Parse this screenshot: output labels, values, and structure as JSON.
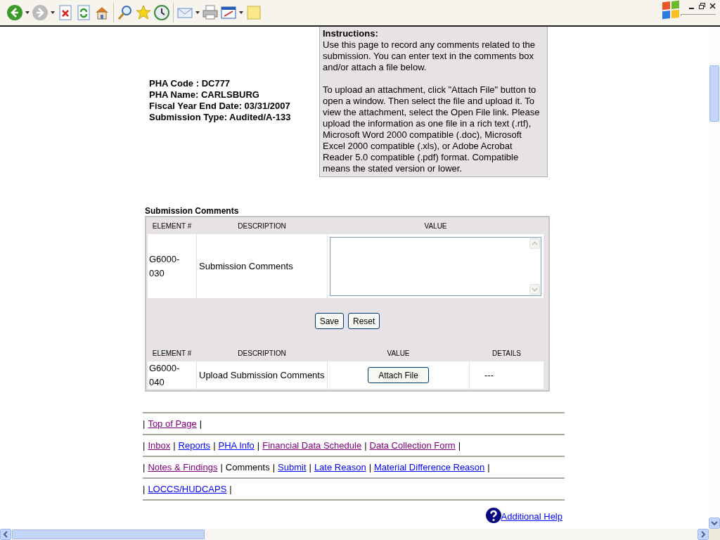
{
  "pha_info": [
    "PHA Code : DC777",
    "PHA Name: CARLSBURG",
    "Fiscal Year End Date: 03/31/2007",
    "Submission Type: Audited/A-133"
  ],
  "instructions": {
    "title": "Instructions:",
    "paragraphs": [
      "Use this page to record any comments related to the submission. You can enter text in the comments box and/or attach a file below.",
      "To upload an attachment, click \"Attach File\" button to open a window. Then select the file and upload it. To view the attachment, select the Open File link. Please upload the information as one file in a rich text (.rtf), Microsoft Word 2000 compatible (.doc), Microsoft Excel 2000 compatible (.xls), or Adobe Acrobat Reader 5.0 compatible (.pdf) format. Compatible means the stated version or lower."
    ]
  },
  "comments": {
    "title": "Submission Comments",
    "table1": {
      "columns": [
        "ELEMENT #",
        "DESCRIPTION",
        "VALUE"
      ],
      "rows": [
        {
          "element": "G6000-030",
          "description": "Submission Comments"
        }
      ]
    },
    "buttons": [
      "Save",
      "Reset"
    ],
    "table2": {
      "columns": [
        "ELEMENT #",
        "DESCRIPTION",
        "VALUE",
        "DETAILS"
      ],
      "rows": [
        {
          "element": "G6000-040",
          "description": "Upload Submission Comments",
          "button": "Attach File",
          "details": "---"
        }
      ]
    }
  },
  "nav_rows": [
    [
      {
        "label": "|",
        "kind": "separator"
      },
      {
        "label": "Top of Page",
        "kind": "link",
        "visited": true
      },
      {
        "label": "|",
        "kind": "separator"
      }
    ],
    [
      {
        "label": "|",
        "kind": "separator"
      },
      {
        "label": "Inbox",
        "kind": "link",
        "visited": true
      },
      {
        "label": "|",
        "kind": "separator"
      },
      {
        "label": "Reports",
        "kind": "link",
        "visited": false
      },
      {
        "label": "|",
        "kind": "separator"
      },
      {
        "label": "PHA Info",
        "kind": "link",
        "visited": false
      },
      {
        "label": "|",
        "kind": "separator"
      },
      {
        "label": "Financial Data Schedule",
        "kind": "link",
        "visited": true
      },
      {
        "label": "|",
        "kind": "separator"
      },
      {
        "label": "Data Collection Form",
        "kind": "link",
        "visited": true
      },
      {
        "label": "|",
        "kind": "separator"
      }
    ],
    [
      {
        "label": "|",
        "kind": "separator"
      },
      {
        "label": "Notes & Findings",
        "kind": "link",
        "visited": true
      },
      {
        "label": "|",
        "kind": "separator"
      },
      {
        "label": "Comments",
        "kind": "current"
      },
      {
        "label": "|",
        "kind": "separator"
      },
      {
        "label": "Submit",
        "kind": "link",
        "visited": false
      },
      {
        "label": "|",
        "kind": "separator"
      },
      {
        "label": "Late Reason",
        "kind": "link",
        "visited": false
      },
      {
        "label": "|",
        "kind": "separator"
      },
      {
        "label": "Material Difference Reason",
        "kind": "link",
        "visited": false
      },
      {
        "label": "|",
        "kind": "separator"
      }
    ],
    [
      {
        "label": "|",
        "kind": "separator"
      },
      {
        "label": "LOCCS/HUDCAPS",
        "kind": "link",
        "visited": false
      },
      {
        "label": "|",
        "kind": "separator"
      }
    ]
  ],
  "help_link": "Additional Help"
}
